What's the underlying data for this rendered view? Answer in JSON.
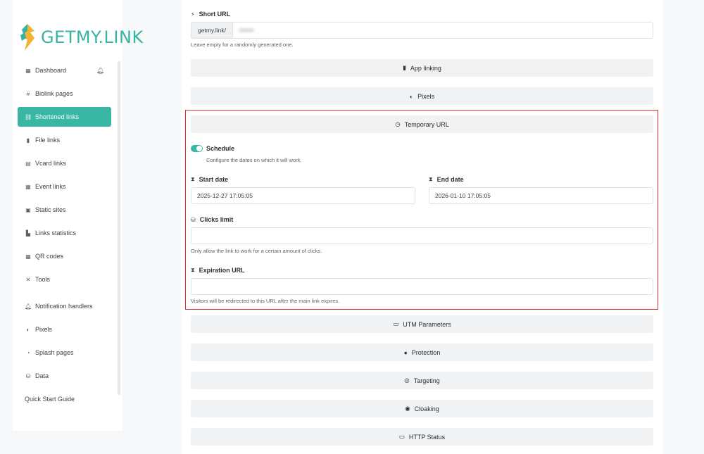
{
  "brand": {
    "logo_text": "GETMY.LINK"
  },
  "sidebar": {
    "items": [
      {
        "label": "Dashboard",
        "icon": "dashboard-icon",
        "glyph": "▦"
      },
      {
        "label": "Biolink pages",
        "icon": "hash-icon",
        "glyph": "#"
      },
      {
        "label": "Shortened links",
        "icon": "link-icon",
        "glyph": "⛓"
      },
      {
        "label": "File links",
        "icon": "file-icon",
        "glyph": "▮"
      },
      {
        "label": "Vcard links",
        "icon": "vcard-icon",
        "glyph": "▤"
      },
      {
        "label": "Event links",
        "icon": "calendar-icon",
        "glyph": "▦"
      },
      {
        "label": "Static sites",
        "icon": "static-site-icon",
        "glyph": "▣"
      },
      {
        "label": "Links statistics",
        "icon": "chart-icon",
        "glyph": "▙"
      },
      {
        "label": "QR codes",
        "icon": "qr-icon",
        "glyph": "▦"
      },
      {
        "label": "Tools",
        "icon": "tools-icon",
        "glyph": "✕"
      },
      {
        "label": "Notification handlers",
        "icon": "bell-icon",
        "glyph": "♪"
      },
      {
        "label": "Pixels",
        "icon": "adjust-icon",
        "glyph": "◐"
      },
      {
        "label": "Splash pages",
        "icon": "splash-icon",
        "glyph": "◔"
      },
      {
        "label": "Data",
        "icon": "database-icon",
        "glyph": "⛁"
      },
      {
        "label": "Quick Start Guide",
        "icon": "",
        "glyph": ""
      }
    ],
    "notification_icon": "bell-icon"
  },
  "form": {
    "short_url": {
      "label": "Short URL",
      "prefix": "getmy.link/",
      "help": "Leave empty for a randomly generated one."
    },
    "sections_top": [
      {
        "label": "App linking",
        "icon": "mobile-icon",
        "glyph": "▮"
      },
      {
        "label": "Pixels",
        "icon": "adjust-icon",
        "glyph": "◐"
      }
    ],
    "temporary_url": {
      "label": "Temporary URL",
      "icon": "clock-icon",
      "schedule_label": "Schedule",
      "schedule_enabled": true,
      "schedule_help": "Configure the dates on which it will work.",
      "start_label": "Start date",
      "start_value": "2025-12-27 17:05:05",
      "end_label": "End date",
      "end_value": "2026-01-10 17:05:05",
      "clicks_label": "Clicks limit",
      "clicks_value": "",
      "clicks_help": "Only allow the link to work for a certain amount of clicks.",
      "expiration_label": "Expiration URL",
      "expiration_value": "",
      "expiration_help": "Visitors will be redirected to this URL after the main link expires."
    },
    "sections_bottom": [
      {
        "label": "UTM Parameters",
        "icon": "keyboard-icon",
        "glyph": "▭"
      },
      {
        "label": "Protection",
        "icon": "user-lock-icon",
        "glyph": "●"
      },
      {
        "label": "Targeting",
        "icon": "target-icon",
        "glyph": "◎"
      },
      {
        "label": "Cloaking",
        "icon": "eye-icon",
        "glyph": "◉"
      },
      {
        "label": "HTTP Status",
        "icon": "server-icon",
        "glyph": "▭"
      }
    ]
  },
  "colors": {
    "accent": "#3ab7a4",
    "highlight": "#e03131"
  }
}
